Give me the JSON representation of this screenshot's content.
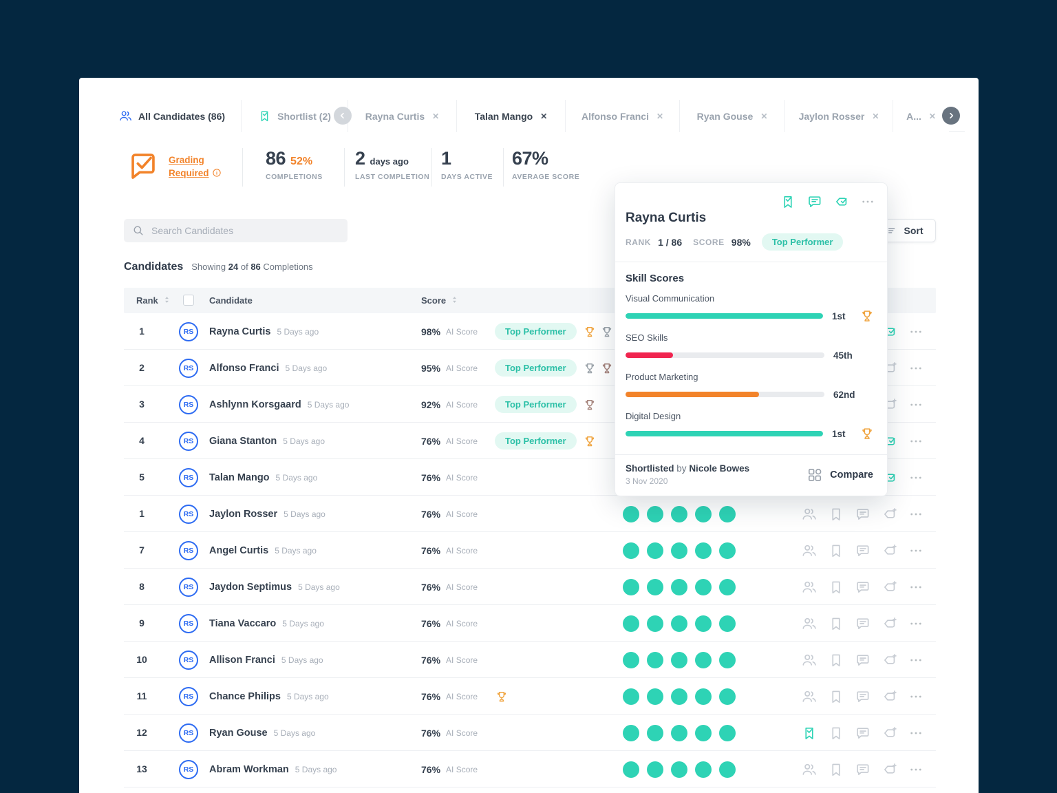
{
  "colors": {
    "teal": "#2ed3b5",
    "blue": "#2d6bf2",
    "orange": "#f2832a",
    "red": "#f0254f",
    "gold": "#f0a43f",
    "silver": "#9aa2a9",
    "bronze": "#a5837b",
    "navy": "#042740"
  },
  "tabs": [
    {
      "label": "All Candidates (86)",
      "icon": "users",
      "state": "active",
      "closable": false
    },
    {
      "label": "Shortlist (2)",
      "icon": "bookmark-check",
      "state": "inactive",
      "closable": false
    },
    {
      "label": "Rayna Curtis",
      "state": "inactive",
      "closable": true
    },
    {
      "label": "Talan Mango",
      "state": "current",
      "closable": true
    },
    {
      "label": "Alfonso Franci",
      "state": "inactive",
      "closable": true
    },
    {
      "label": "Ryan Gouse",
      "state": "inactive",
      "closable": true
    },
    {
      "label": "Jaylon Rosser",
      "state": "inactive",
      "closable": true
    },
    {
      "label": "A...",
      "state": "inactive",
      "closable": true
    }
  ],
  "stats": {
    "grading": {
      "label_line1": "Grading",
      "label_line2": "Required"
    },
    "metrics": [
      {
        "value": "86",
        "accent": "52%",
        "accent_style": "orange",
        "label": "COMPLETIONS"
      },
      {
        "value": "2",
        "accent": "days ago",
        "accent_style": "dark",
        "label": "LAST COMPLETION"
      },
      {
        "value": "1",
        "accent": "",
        "accent_style": "",
        "label": "DAYS ACTIVE"
      },
      {
        "value": "67%",
        "accent": "",
        "accent_style": "",
        "label": "AVERAGE SCORE"
      }
    ]
  },
  "search": {
    "placeholder": "Search Candidates"
  },
  "toolbar": {
    "sort_label": "Sort"
  },
  "list_header": {
    "title": "Candidates",
    "showing": "Showing",
    "shown": "24",
    "of": "of",
    "total": "86",
    "completions": "Completions"
  },
  "table": {
    "columns": {
      "rank": "Rank",
      "candidate": "Candidate",
      "score": "Score"
    },
    "time_label": "5 Days ago",
    "score_label": "AI Score",
    "badge_label": "Top Performer",
    "avatar_initials": "RS",
    "rows": [
      {
        "rank": "1",
        "name": "Rayna Curtis",
        "score": "98%",
        "badge": true,
        "trophies": [
          "gold",
          "silver",
          "bronze"
        ],
        "dots": 0,
        "actions": [
          "users:t",
          "bookmark-check:t",
          "comment:t",
          "tag-check:t"
        ]
      },
      {
        "rank": "2",
        "name": "Alfonso Franci",
        "score": "95%",
        "badge": true,
        "trophies": [
          "silver",
          "bronze"
        ],
        "dots": 0,
        "actions": [
          "users",
          "bookmark",
          "comment",
          "tag-plus"
        ]
      },
      {
        "rank": "3",
        "name": "Ashlynn Korsgaard",
        "score": "92%",
        "badge": true,
        "trophies": [
          "bronze"
        ],
        "dots": 0,
        "actions": [
          "users",
          "bookmark",
          "comment",
          "tag-plus"
        ]
      },
      {
        "rank": "4",
        "name": "Giana Stanton",
        "score": "76%",
        "badge": true,
        "trophies": [
          "gold"
        ],
        "dots": 0,
        "actions": [
          "users:t",
          "bookmark-check:t",
          "comment:t",
          "tag-check:t"
        ]
      },
      {
        "rank": "5",
        "name": "Talan Mango",
        "score": "76%",
        "badge": false,
        "trophies": [],
        "dots": 5,
        "actions": [
          "users:t",
          "bookmark-check:t",
          "comment:t",
          "tag-check:t"
        ]
      },
      {
        "rank": "1",
        "name": "Jaylon Rosser",
        "score": "76%",
        "badge": false,
        "trophies": [],
        "dots": 5,
        "actions": [
          "users",
          "bookmark",
          "comment",
          "tag-plus"
        ]
      },
      {
        "rank": "7",
        "name": "Angel Curtis",
        "score": "76%",
        "badge": false,
        "trophies": [],
        "dots": 5,
        "actions": [
          "users",
          "bookmark",
          "comment",
          "tag-plus"
        ]
      },
      {
        "rank": "8",
        "name": "Jaydon Septimus",
        "score": "76%",
        "badge": false,
        "trophies": [],
        "dots": 5,
        "actions": [
          "users",
          "bookmark",
          "comment",
          "tag-plus"
        ]
      },
      {
        "rank": "9",
        "name": "Tiana Vaccaro",
        "score": "76%",
        "badge": false,
        "trophies": [],
        "dots": 5,
        "actions": [
          "users",
          "bookmark",
          "comment",
          "tag-plus"
        ]
      },
      {
        "rank": "10",
        "name": "Allison Franci",
        "score": "76%",
        "badge": false,
        "trophies": [],
        "dots": 5,
        "actions": [
          "users",
          "bookmark",
          "comment",
          "tag-plus"
        ]
      },
      {
        "rank": "11",
        "name": "Chance Philips",
        "score": "76%",
        "badge": false,
        "trophies": [
          "gold"
        ],
        "dots": 5,
        "actions": [
          "users",
          "bookmark",
          "comment",
          "tag-plus"
        ]
      },
      {
        "rank": "12",
        "name": "Ryan Gouse",
        "score": "76%",
        "badge": false,
        "trophies": [],
        "dots": 5,
        "actions": [
          "bookmark-check:t",
          "bookmark",
          "comment",
          "tag-plus"
        ]
      },
      {
        "rank": "13",
        "name": "Abram Workman",
        "score": "76%",
        "badge": false,
        "trophies": [],
        "dots": 5,
        "actions": [
          "users",
          "bookmark",
          "comment",
          "tag-plus"
        ]
      }
    ]
  },
  "popup": {
    "name": "Rayna Curtis",
    "rank_label": "RANK",
    "rank_value": "1 / 86",
    "score_label": "SCORE",
    "score_value": "98%",
    "badge": "Top Performer",
    "skills_title": "Skill Scores",
    "skills": [
      {
        "name": "Visual Communication",
        "percent": 100,
        "rank": "1st",
        "trophy": true,
        "color": "teal"
      },
      {
        "name": "SEO Skills",
        "percent": 24,
        "rank": "45th",
        "trophy": false,
        "color": "red"
      },
      {
        "name": "Product Marketing",
        "percent": 67,
        "rank": "62nd",
        "trophy": false,
        "color": "orange"
      },
      {
        "name": "Digital Design",
        "percent": 100,
        "rank": "1st",
        "trophy": true,
        "color": "teal"
      }
    ],
    "footer": {
      "shortlisted": "Shortlisted",
      "by": "by",
      "author": "Nicole Bowes",
      "date": "3 Nov 2020",
      "compare_label": "Compare"
    }
  }
}
